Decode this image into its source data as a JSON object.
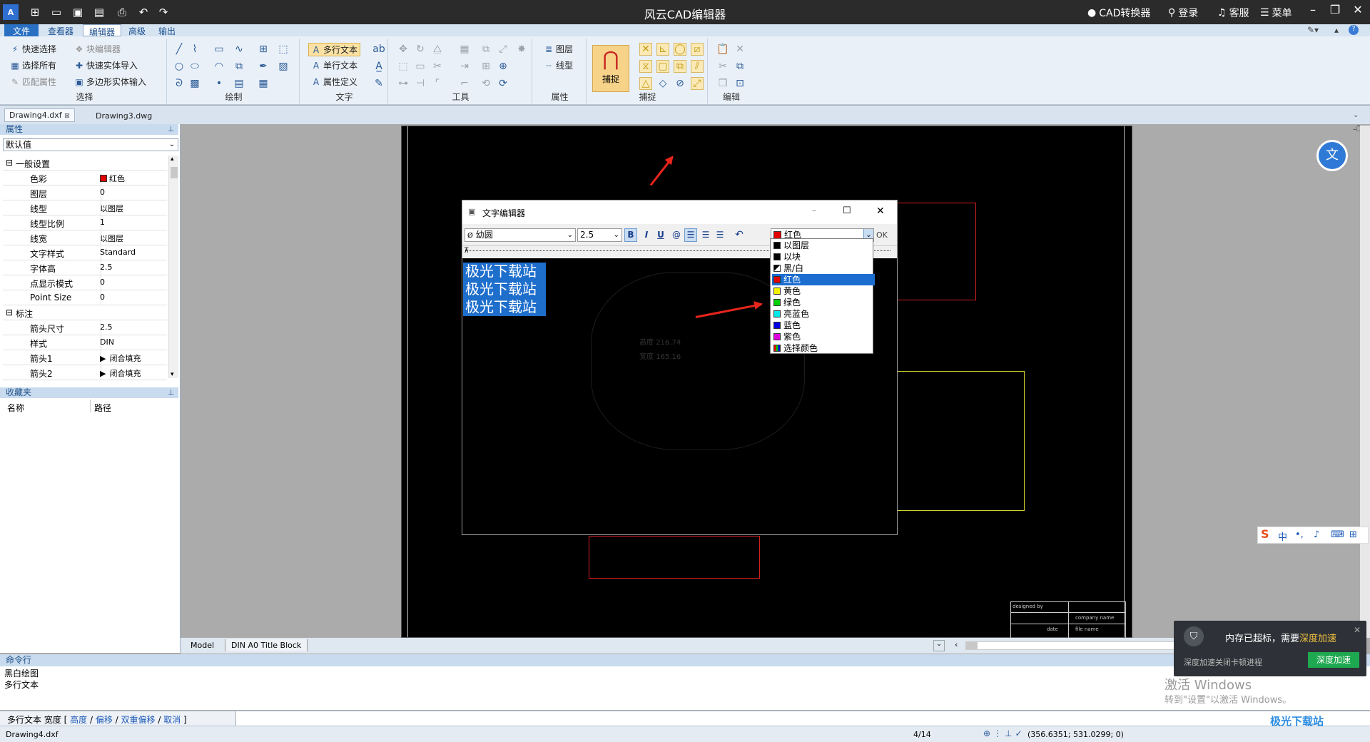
{
  "app": {
    "title": "风云CAD编辑器"
  },
  "titlebar": {
    "converter": "CAD转换器",
    "login": "登录",
    "service": "客服",
    "menu": "菜单"
  },
  "menubar": {
    "items": [
      "文件",
      "查看器",
      "编辑器",
      "高级",
      "输出"
    ],
    "selected": "编辑器"
  },
  "ribbon": {
    "select": {
      "label": "选择",
      "items": [
        "快速选择",
        "选择所有",
        "匹配属性",
        "块编辑器",
        "快速实体导入",
        "多边形实体输入"
      ]
    },
    "draw": {
      "label": "绘制"
    },
    "text": {
      "label": "文字",
      "items": [
        "多行文本",
        "单行文本",
        "属性定义"
      ]
    },
    "tools": {
      "label": "工具"
    },
    "props": {
      "label": "属性",
      "items": [
        "图层",
        "线型"
      ]
    },
    "snap": {
      "label": "捕捉",
      "button": "捕捉"
    },
    "edit": {
      "label": "编辑"
    }
  },
  "doctabs": [
    "Drawing4.dxf",
    "Drawing3.dwg"
  ],
  "properties": {
    "header": "属性",
    "selector": "默认值",
    "section1": "一般设置",
    "rows1": [
      {
        "k": "色彩",
        "v": "红色"
      },
      {
        "k": "图层",
        "v": "0"
      },
      {
        "k": "线型",
        "v": "以图层"
      },
      {
        "k": "线型比例",
        "v": "1"
      },
      {
        "k": "线宽",
        "v": "以图层"
      },
      {
        "k": "文字样式",
        "v": "Standard"
      },
      {
        "k": "字体高",
        "v": "2.5"
      },
      {
        "k": "点显示模式",
        "v": "0"
      },
      {
        "k": "Point Size",
        "v": "0"
      }
    ],
    "section2": "标注",
    "rows2": [
      {
        "k": "箭头尺寸",
        "v": "2.5"
      },
      {
        "k": "样式",
        "v": "DIN"
      },
      {
        "k": "箭头1",
        "v": "闭合填充"
      },
      {
        "k": "箭头2",
        "v": "闭合填充"
      }
    ]
  },
  "favorites": {
    "header": "收藏夹",
    "col1": "名称",
    "col2": "路径"
  },
  "layout_tabs": [
    "Model",
    "DIN A0 Title Block"
  ],
  "editor": {
    "title": "文字编辑器",
    "font": "幼圆",
    "size": "2.5",
    "color": "红色",
    "ok": "OK",
    "lines": [
      "极光下载站",
      "极光下载站",
      "极光下载站"
    ],
    "bold": "B",
    "italic": "I",
    "underline": "U",
    "at": "@"
  },
  "color_options": [
    {
      "label": "以图层",
      "color": "#000000"
    },
    {
      "label": "以块",
      "color": "#000000"
    },
    {
      "label": "黑/白",
      "color": "#000000"
    },
    {
      "label": "红色",
      "color": "#e00000"
    },
    {
      "label": "黄色",
      "color": "#f4f400"
    },
    {
      "label": "绿色",
      "color": "#00d000"
    },
    {
      "label": "亮蓝色",
      "color": "#00e8e8"
    },
    {
      "label": "蓝色",
      "color": "#0000e0"
    },
    {
      "label": "紫色",
      "color": "#e000e0"
    },
    {
      "label": "选择颜色",
      "color": "#888888"
    }
  ],
  "selected_color": "红色",
  "drawing": {
    "dim1": "高度",
    "dim1v": "216.74",
    "dim2": "宽度",
    "dim2v": "165.16",
    "tb1": "designed by",
    "tb2": "date",
    "tb3": "company name",
    "tb4": "file name"
  },
  "command": {
    "header": "命令行",
    "history": [
      "黑白绘图",
      "多行文本"
    ],
    "prompt": "多行文本 宽度",
    "options": [
      "高度",
      "偏移",
      "双重偏移",
      "取消"
    ]
  },
  "status": {
    "file": "Drawing4.dxf",
    "page": "4/14",
    "coords": "(356.6351; 531.0299; 0)"
  },
  "toast": {
    "message": "内存已超标，需要",
    "link": "深度加速",
    "sub": "深度加速关闭卡顿进程",
    "button": "深度加速"
  },
  "watermark": {
    "line1": "激活 Windows",
    "line2": "转到\"设置\"以激活 Windows。"
  },
  "ime": {
    "lang": "中"
  },
  "site_logo": "极光下载站"
}
